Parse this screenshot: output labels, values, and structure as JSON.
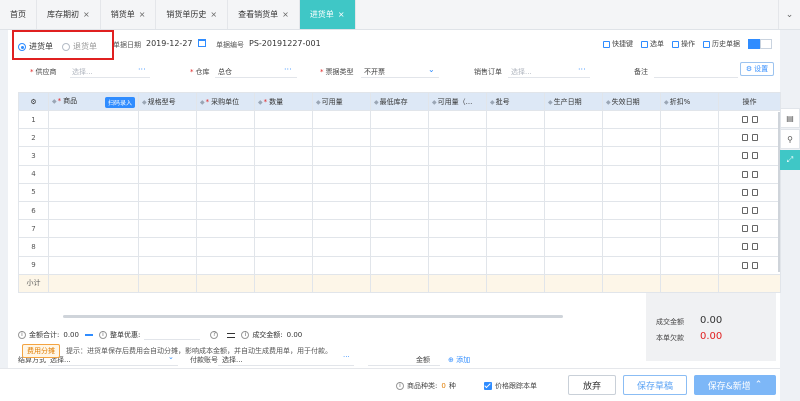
{
  "tabs": [
    {
      "label": "首页",
      "closable": false,
      "active": false
    },
    {
      "label": "库存期初",
      "closable": true,
      "active": false
    },
    {
      "label": "销货单",
      "closable": true,
      "active": false
    },
    {
      "label": "销货单历史",
      "closable": true,
      "active": false
    },
    {
      "label": "查看销货单",
      "closable": true,
      "active": false
    },
    {
      "label": "进货单",
      "closable": true,
      "active": true
    }
  ],
  "header": {
    "radio_purchase": "进货单",
    "radio_return": "退货单",
    "date_label": "单据日期",
    "date_value": "2019-12-27",
    "docno_label": "单据编号",
    "docno_value": "PS-20191227-001",
    "tools": [
      "快捷键",
      "选单",
      "操作",
      "历史单据"
    ]
  },
  "fields": {
    "supplier_label": "供应商",
    "supplier_placeholder": "选择...",
    "warehouse_label": "仓库",
    "warehouse_value": "总仓",
    "ticket_label": "票据类型",
    "ticket_value": "不开票",
    "sales_order_label": "销售订单",
    "sales_order_placeholder": "选择...",
    "remark_label": "备注",
    "settings_label": "设置"
  },
  "grid": {
    "headers": {
      "product": "商品",
      "scan": "扫码录入",
      "spec": "规格型号",
      "unit": "采购单位",
      "qty": "数量",
      "avail": "可用量",
      "min_stock": "最低库存",
      "avail2": "可用量（...",
      "batch": "批号",
      "prod_date": "生产日期",
      "exp_date": "失效日期",
      "discount": "折扣%",
      "ops": "操作"
    },
    "rows": [
      "1",
      "2",
      "3",
      "4",
      "5",
      "6",
      "7",
      "8",
      "9"
    ],
    "subtotal_label": "小计"
  },
  "totals": {
    "amount_label": "金额合计:",
    "amount_value": "0.00",
    "discount_label": "整单优惠:",
    "deal_label": "成交金额:",
    "deal_value": "0.00"
  },
  "payment": {
    "method_label": "结算方式",
    "method_placeholder": "选择...",
    "account_label": "付款账号",
    "account_placeholder": "选择...",
    "amount_placeholder": "金额",
    "add_label": "添加"
  },
  "summary": {
    "deal_label": "成交金额",
    "deal_value": "0.00",
    "owed_label": "本单欠款",
    "owed_value": "0.00"
  },
  "hint": {
    "fee_button": "费用分摊",
    "text": "提示：进货单保存后费用会自动分摊，影响成本金额，并自动生成费用单，用于付款。"
  },
  "footer": {
    "product_types_label": "商品种类:",
    "product_types_value": "0",
    "product_types_unit": "种",
    "price_track_label": "价格跟踪本单",
    "discard": "放弃",
    "save_draft": "保存草稿",
    "save_new": "保存&新增"
  },
  "colors": {
    "accent": "#3fc7c6",
    "primary": "#2f8cff",
    "required": "#e02020",
    "owed": "#e02020"
  }
}
